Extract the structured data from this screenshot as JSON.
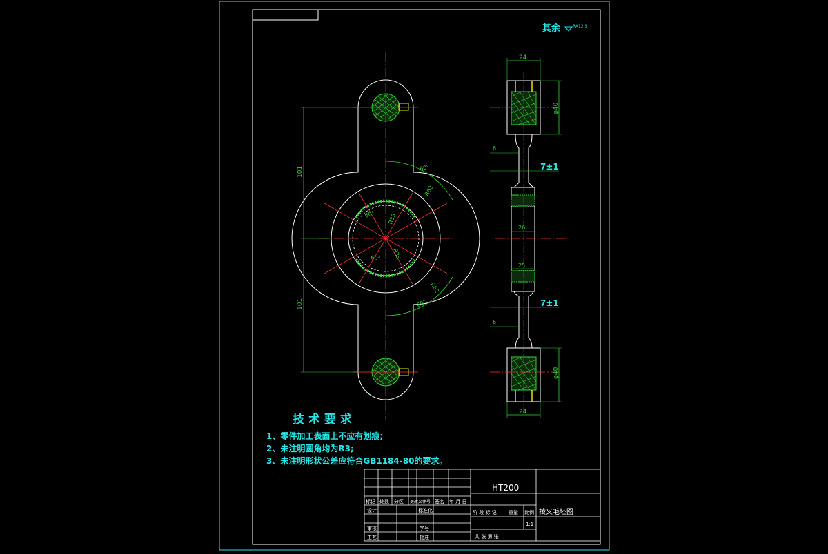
{
  "surface_finish": {
    "label": "其余",
    "value": "RA12.5"
  },
  "dimensions": {
    "center_upper": "101",
    "center_lower": "101",
    "angle_top": "60°",
    "angle_bottom": "60°",
    "angle_inner_upper": "60°",
    "angle_inner_lower": "60°",
    "r_outer_upper": "R62",
    "r_outer_lower": "R62",
    "r_inner_upper": "R35",
    "r_inner_lower": "R35",
    "width_top": "24",
    "width_bottom": "24",
    "dia_top": "φ40",
    "dia_bottom": "φ40",
    "web_upper": "6",
    "web_lower": "6",
    "thick_upper": "7±1",
    "thick_lower": "7±1",
    "hub_upper": "26",
    "hub_lower": "25"
  },
  "tech_requirements": {
    "title": "技 术 要 求",
    "items": [
      "1、零件加工表面上不应有划痕;",
      "2、未注明圆角均为R3;",
      "3、未注明形状公差应符合GB1184-80的要求。"
    ]
  },
  "title_block": {
    "material": "HT200",
    "drawing_name": "拨叉毛坯图",
    "header_cols": [
      "标记",
      "处数",
      "分区",
      "更改文件号",
      "签名",
      "年 月 日"
    ],
    "row_labels": [
      "设计",
      "标准化",
      "审核",
      "学号",
      "工艺",
      "批准"
    ],
    "stage_cols": [
      "阶 段 标 记",
      "重量",
      "比例"
    ],
    "scale": "1:1",
    "sheet": "共    张  第    张"
  }
}
